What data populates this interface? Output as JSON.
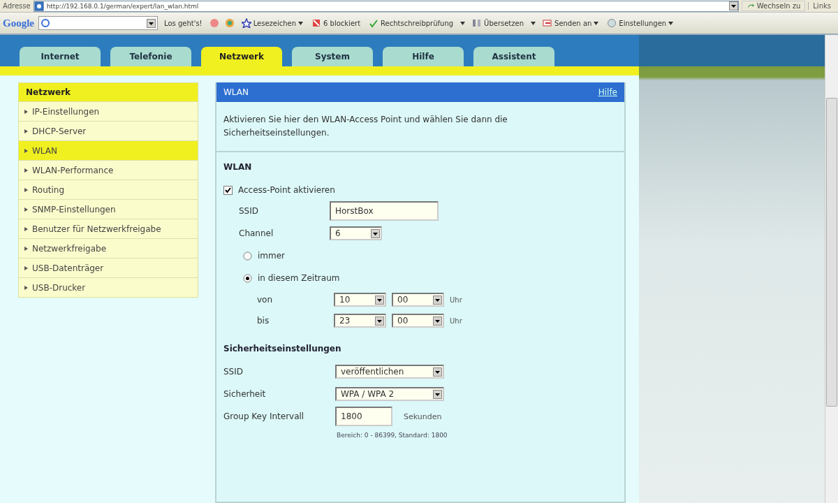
{
  "browser": {
    "address_label": "Adresse",
    "url": "http://192.168.0.1/german/expert/lan_wlan.html",
    "go_button": "Wechseln zu",
    "links": "Links",
    "toolbar": {
      "logo": "Google",
      "search_button": "Los geht's!",
      "items": [
        {
          "kind": "menu",
          "label": "Lesezeichen"
        },
        {
          "kind": "plain",
          "label": "6 blockiert"
        },
        {
          "kind": "split",
          "label": "Rechtschreibprüfung"
        },
        {
          "kind": "split",
          "label": "Übersetzen"
        },
        {
          "kind": "menu",
          "label": "Senden an"
        },
        {
          "kind": "menu",
          "label": "Einstellungen"
        }
      ]
    }
  },
  "tabs": [
    {
      "label": "Internet",
      "selected": false
    },
    {
      "label": "Telefonie",
      "selected": false
    },
    {
      "label": "Netzwerk",
      "selected": true
    },
    {
      "label": "System",
      "selected": false
    },
    {
      "label": "Hilfe",
      "selected": false
    },
    {
      "label": "Assistent",
      "selected": false
    }
  ],
  "sidebar": {
    "title": "Netzwerk",
    "items": [
      {
        "label": "IP-Einstellungen",
        "selected": false
      },
      {
        "label": "DHCP-Server",
        "selected": false
      },
      {
        "label": "WLAN",
        "selected": true
      },
      {
        "label": "WLAN-Performance",
        "selected": false
      },
      {
        "label": "Routing",
        "selected": false
      },
      {
        "label": "SNMP-Einstellungen",
        "selected": false
      },
      {
        "label": "Benutzer für Netzwerkfreigabe",
        "selected": false
      },
      {
        "label": "Netzwerkfreigabe",
        "selected": false
      },
      {
        "label": "USB-Datenträger",
        "selected": false
      },
      {
        "label": "USB-Drucker",
        "selected": false
      }
    ]
  },
  "panel": {
    "title": "WLAN",
    "help_link": "Hilfe",
    "intro": "Aktivieren Sie hier den WLAN-Access Point und wählen Sie dann die Sicherheitseinstellungen.",
    "wlan": {
      "heading": "WLAN",
      "access_point": {
        "label": "Access-Point aktivieren",
        "checked": true
      },
      "ssid": {
        "label": "SSID",
        "value": "HorstBox"
      },
      "channel": {
        "label": "Channel",
        "value": "6"
      },
      "schedule": [
        {
          "label": "immer",
          "selected": false
        },
        {
          "label": "in diesem Zeitraum",
          "selected": true
        }
      ],
      "times": [
        {
          "label": "von",
          "hour": "10",
          "minute": "00",
          "unit": "Uhr"
        },
        {
          "label": "bis",
          "hour": "23",
          "minute": "00",
          "unit": "Uhr"
        }
      ]
    },
    "security": {
      "heading": "Sicherheitseinstellungen",
      "rows": [
        {
          "kind": "select",
          "label": "SSID",
          "value": "veröffentlichen"
        },
        {
          "kind": "select",
          "label": "Sicherheit",
          "value": "WPA / WPA 2"
        },
        {
          "kind": "input",
          "label": "Group Key Intervall",
          "value": "1800",
          "unit": "Sekunden"
        }
      ],
      "hint": "Bereich: 0 - 86399, Standard: 1800"
    }
  }
}
